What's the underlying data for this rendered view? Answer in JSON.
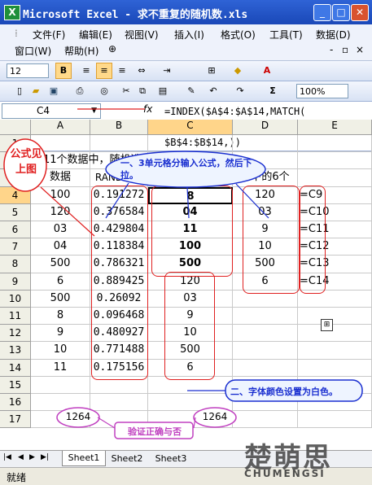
{
  "window": {
    "title": "Microsoft Excel - 求不重复的随机数.xls",
    "app_icon": "X"
  },
  "menu": {
    "row1": [
      "文件(F)",
      "编辑(E)",
      "视图(V)",
      "插入(I)",
      "格式(O)",
      "工具(T)",
      "数据(D)"
    ],
    "row2": [
      "窗口(W)",
      "帮助(H)"
    ]
  },
  "toolbar": {
    "font_size": "12",
    "bold": "B",
    "zoom": "100%",
    "sigma": "Σ"
  },
  "formula_bar": {
    "name_box": "C4",
    "fx": "fx",
    "formula": "=INDEX($A$4:$A$14,MATCH(\nSMALL($B$4:$B$14,ROW(1:1)),\n$B$4:$B$14,))"
  },
  "columns": [
    "A",
    "B",
    "C",
    "D",
    "E"
  ],
  "rows": [
    "1",
    "2",
    "3",
    "4",
    "5",
    "6",
    "7",
    "8",
    "9",
    "10",
    "11",
    "12",
    "13",
    "14",
    "15",
    "16",
    "17"
  ],
  "sheet": {
    "row2_text": "从11个数据中，随机选出5个不重复的数据",
    "headers": [
      "数据",
      "RAND函数",
      "随机选出5个",
      "剩下的6个"
    ],
    "col_a": [
      "100",
      "120",
      "03",
      "04",
      "500",
      "6",
      "500",
      "8",
      "9",
      "10",
      "11"
    ],
    "col_b": [
      "0.191272",
      "0.376584",
      "0.429804",
      "0.118384",
      "0.786321",
      "0.889425",
      "0.26092",
      "0.096468",
      "0.480927",
      "0.771488",
      "0.175156"
    ],
    "col_c": [
      "8",
      "04",
      "11",
      "100",
      "500",
      "120",
      "03",
      "9",
      "10",
      "500",
      "6"
    ],
    "col_d": [
      "120",
      "03",
      "9",
      "10",
      "500",
      "6"
    ],
    "col_e": [
      "=C9",
      "=C10",
      "=C11",
      "=C12",
      "=C13",
      "=C14"
    ],
    "row16_a": "1264",
    "row16_d": "1264"
  },
  "annotations": {
    "formula_see_above": "公式见上图",
    "callout_top": "一、3单元格分输入公式，然后下拉。",
    "callout_font": "二、字体颜色设置为白色。",
    "verify": "验证正确与否"
  },
  "sheet_tabs": [
    "Sheet1",
    "Sheet2",
    "Sheet3"
  ],
  "status": {
    "text": "就绪"
  },
  "watermark": {
    "text": "CHUMENGSI",
    "cn": "楚萌思"
  },
  "colors": {
    "title_bar": "#1a48b8",
    "annotation_red": "#e02020",
    "annotation_blue": "#1a2fd0",
    "callout_fill": "#eef4ff"
  }
}
